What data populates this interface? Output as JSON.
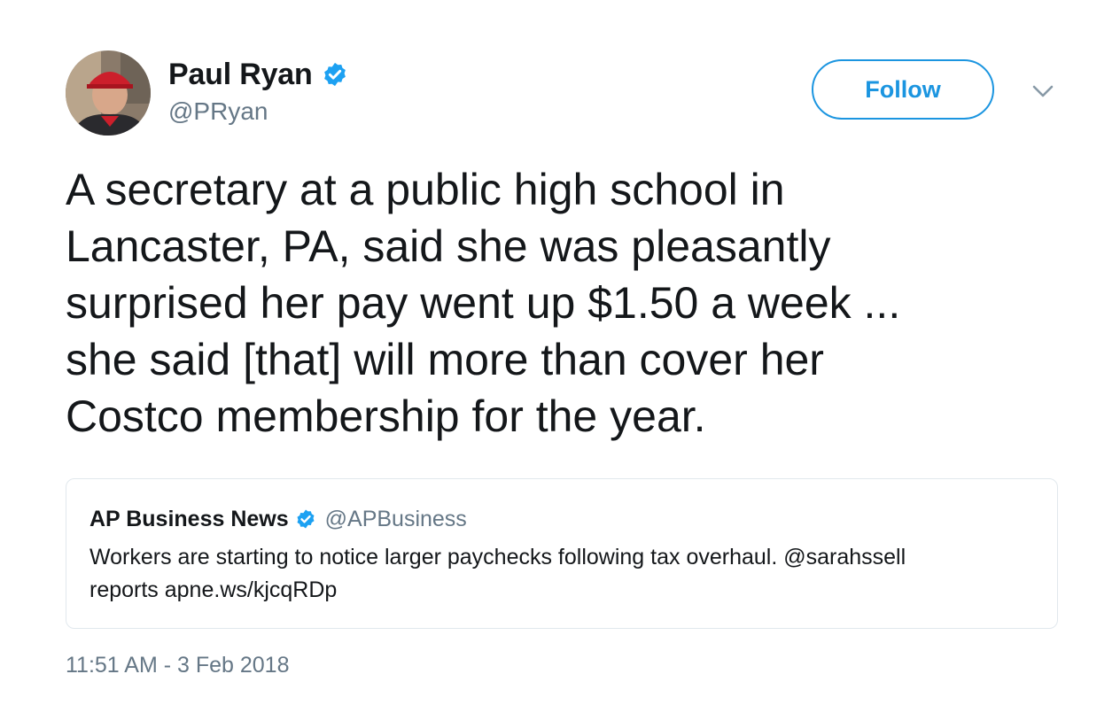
{
  "author": {
    "name": "Paul Ryan",
    "handle": "@PRyan",
    "verified": true,
    "avatar": "profile-photo"
  },
  "actions": {
    "follow_label": "Follow",
    "more_icon": "chevron-down-icon"
  },
  "tweet": {
    "lines": [
      "A secretary at a public high school in",
      "Lancaster, PA, said she was pleasantly",
      "surprised her pay went up $1.50 a week ...",
      "she said [that] will more than cover her",
      "Costco membership for the year."
    ],
    "timestamp": "11:51 AM - 3 Feb 2018"
  },
  "quoted_tweet": {
    "name": "AP Business News",
    "handle": "@APBusiness",
    "verified": true,
    "lines": [
      "Workers are starting to notice larger paychecks following tax overhaul. @sarahssell",
      "reports apne.ws/kjcqRDp"
    ]
  },
  "colors": {
    "accent": "#1b95e0",
    "text": "#14171a",
    "secondary": "#657786",
    "border": "#e1e8ed",
    "verified": "#1da1f2"
  }
}
